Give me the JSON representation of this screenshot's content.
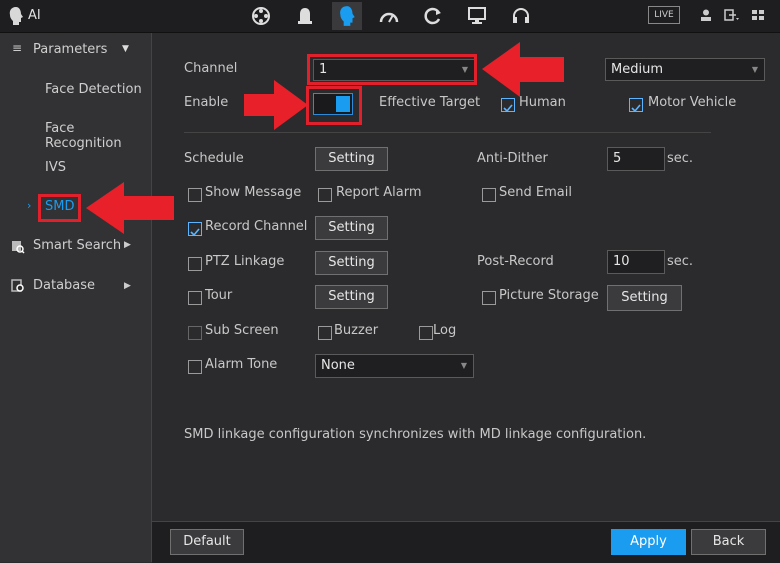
{
  "app": {
    "title": "AI"
  },
  "topbar": {
    "icons": [
      "film-reel-icon",
      "bell-icon",
      "ai-head-icon",
      "gauge-icon",
      "refresh-icon",
      "monitor-icon",
      "headset-icon"
    ],
    "live_label": "LIVE"
  },
  "sidebar": {
    "parameters_label": "Parameters",
    "items": [
      {
        "label": "Face Detection"
      },
      {
        "label": "Face Recognition"
      },
      {
        "label": "IVS"
      },
      {
        "label": "SMD"
      }
    ],
    "smart_search_label": "Smart Search",
    "database_label": "Database"
  },
  "form": {
    "channel_label": "Channel",
    "channel_value": "1",
    "sensitivity_value": "Medium",
    "enable_label": "Enable",
    "enable_on": true,
    "effective_target_label": "Effective Target",
    "human_label": "Human",
    "human_checked": true,
    "motor_vehicle_label": "Motor Vehicle",
    "motor_vehicle_checked": true,
    "schedule_label": "Schedule",
    "setting_label": "Setting",
    "anti_dither_label": "Anti-Dither",
    "anti_dither_value": "5",
    "sec_label": "sec.",
    "show_message_label": "Show Message",
    "report_alarm_label": "Report Alarm",
    "send_email_label": "Send Email",
    "record_channel_label": "Record Channel",
    "record_channel_checked": true,
    "ptz_linkage_label": "PTZ Linkage",
    "post_record_label": "Post-Record",
    "post_record_value": "10",
    "tour_label": "Tour",
    "picture_storage_label": "Picture Storage",
    "sub_screen_label": "Sub Screen",
    "buzzer_label": "Buzzer",
    "log_label": "Log",
    "alarm_tone_label": "Alarm Tone",
    "alarm_tone_value": "None",
    "note": "SMD linkage configuration synchronizes with MD linkage configuration."
  },
  "footer": {
    "default_label": "Default",
    "apply_label": "Apply",
    "back_label": "Back"
  },
  "colors": {
    "accent": "#1a9cf0",
    "highlight": "#e0202a"
  }
}
